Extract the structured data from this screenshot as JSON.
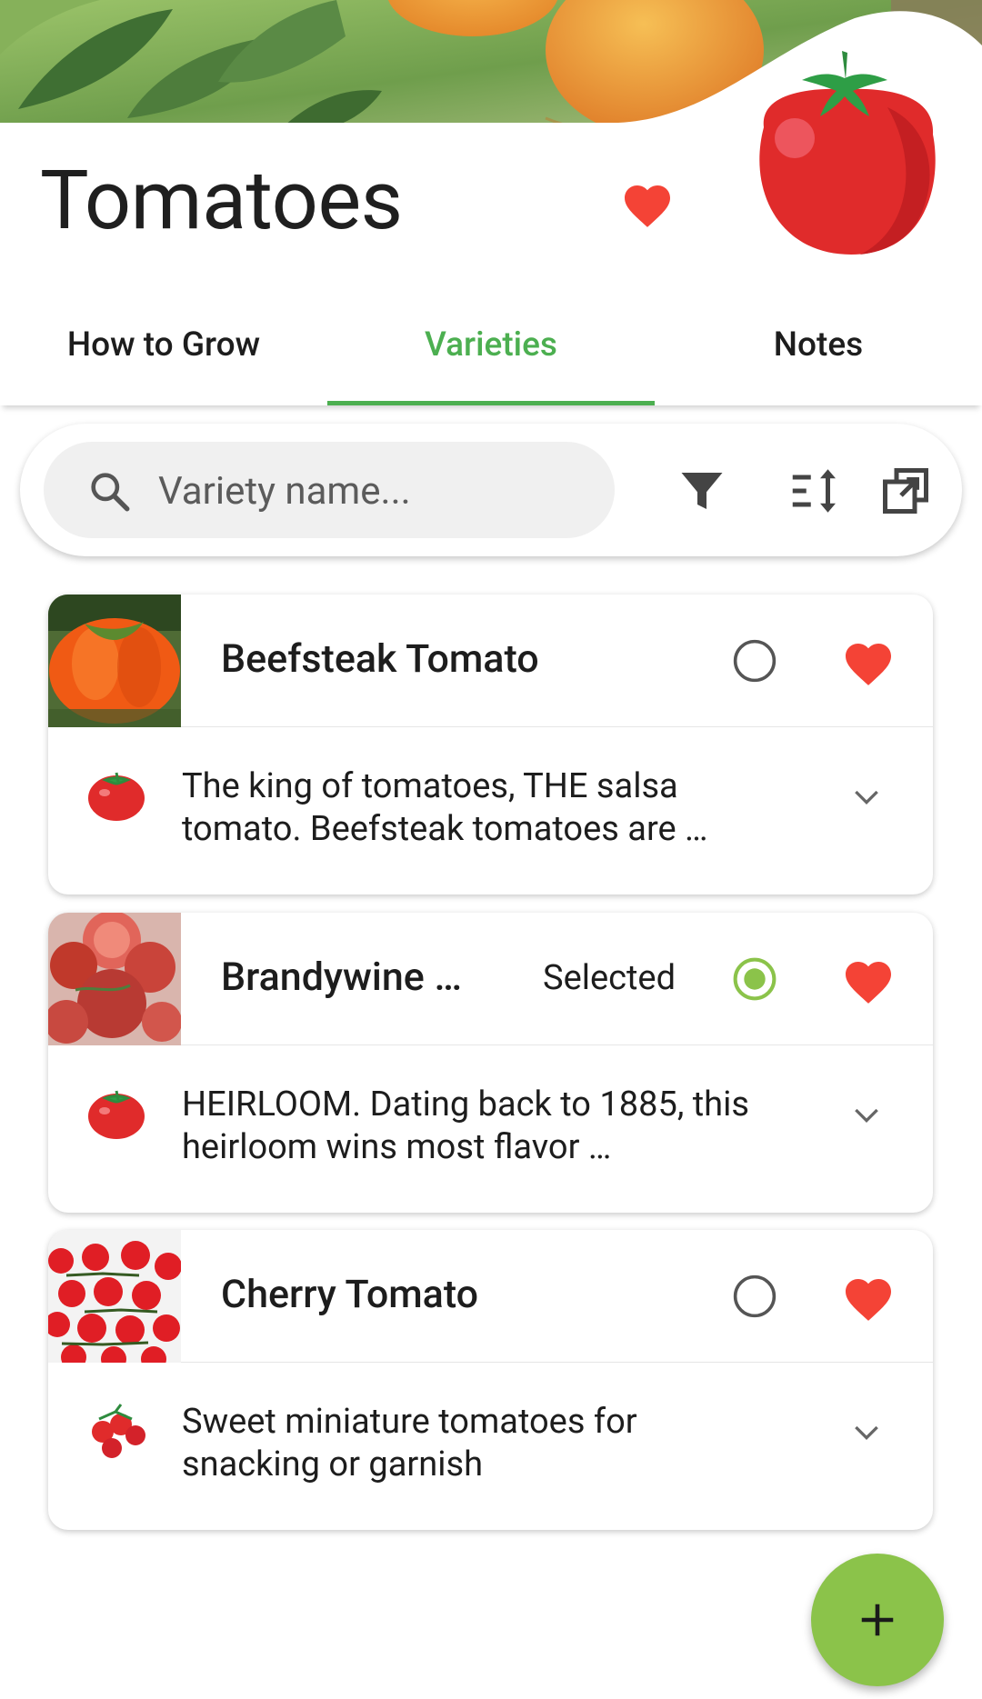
{
  "app": {
    "title": "Tomatoes",
    "accent_color": "#4caf50",
    "favorite_color": "#f44336",
    "fab_color": "#8bc34a"
  },
  "header": {
    "favorite_icon": "heart-icon",
    "favorited": true,
    "logo_icon": "tomato-icon"
  },
  "tabs": [
    {
      "label": "How to Grow",
      "active": false
    },
    {
      "label": "Varieties",
      "active": true
    },
    {
      "label": "Notes",
      "active": false
    }
  ],
  "search": {
    "placeholder": "Variety name...",
    "value": "",
    "icons": [
      "search-icon",
      "filter-icon",
      "sort-icon",
      "compare-icon"
    ]
  },
  "varieties": [
    {
      "name": "Beefsteak Tomato",
      "status": "",
      "selected": false,
      "favorite": true,
      "description": "The king of tomatoes, THE salsa tomato. Beefsteak tomatoes are …",
      "icon": "tomato-icon"
    },
    {
      "name": "Brandywine …",
      "status": "Selected",
      "selected": true,
      "favorite": true,
      "description": "HEIRLOOM. Dating back to 1885, this heirloom wins most flavor …",
      "icon": "tomato-icon"
    },
    {
      "name": "Cherry Tomato",
      "status": "",
      "selected": false,
      "favorite": true,
      "description": "Sweet miniature tomatoes for snacking or garnish",
      "icon": "cherry-tomato-icon"
    }
  ],
  "fab": {
    "icon": "plus-icon"
  }
}
